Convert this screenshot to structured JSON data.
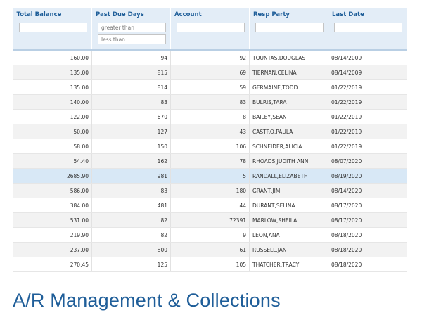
{
  "table": {
    "headers": [
      "Total Balance",
      "Past Due Days",
      "Account",
      "Resp Party",
      "Last Date"
    ],
    "filters": {
      "past_due_greater_placeholder": "greater than",
      "past_due_less_placeholder": "less than"
    },
    "rows": [
      [
        "160.00",
        "94",
        "92",
        "TOUNTAS,DOUGLAS",
        "08/14/2009"
      ],
      [
        "135.00",
        "815",
        "69",
        "TIERNAN,CELINA",
        "08/14/2009"
      ],
      [
        "135.00",
        "814",
        "59",
        "GERMAINE,TODD",
        "01/22/2019"
      ],
      [
        "140.00",
        "83",
        "83",
        "BULRIS,TARA",
        "01/22/2019"
      ],
      [
        "122.00",
        "670",
        "8",
        "BAILEY,SEAN",
        "01/22/2019"
      ],
      [
        "50.00",
        "127",
        "43",
        "CASTRO,PAULA",
        "01/22/2019"
      ],
      [
        "58.00",
        "150",
        "106",
        "SCHNEIDER,ALICIA",
        "01/22/2019"
      ],
      [
        "54.40",
        "162",
        "78",
        "RHOADS,JUDITH ANN",
        "08/07/2020"
      ],
      [
        "2685.90",
        "981",
        "5",
        "RANDALL,ELIZABETH",
        "08/19/2020"
      ],
      [
        "586.00",
        "83",
        "180",
        "GRANT,JIM",
        "08/14/2020"
      ],
      [
        "384.00",
        "481",
        "44",
        "DURANT,SELINA",
        "08/17/2020"
      ],
      [
        "531.00",
        "82",
        "72391",
        "MARLOW,SHEILA",
        "08/17/2020"
      ],
      [
        "219.90",
        "82",
        "9",
        "LEON,ANA",
        "08/18/2020"
      ],
      [
        "237.00",
        "800",
        "61",
        "RUSSELL,JAN",
        "08/18/2020"
      ],
      [
        "270.45",
        "125",
        "105",
        "THATCHER,TRACY",
        "08/18/2020"
      ]
    ],
    "selected_row_index": 8
  },
  "caption": "A/R Management & Collections",
  "colors": {
    "header_bg": "#e3edf7",
    "header_text": "#1f5e99",
    "selected_row_bg": "#d8e8f6",
    "caption": "#1f5e99"
  }
}
